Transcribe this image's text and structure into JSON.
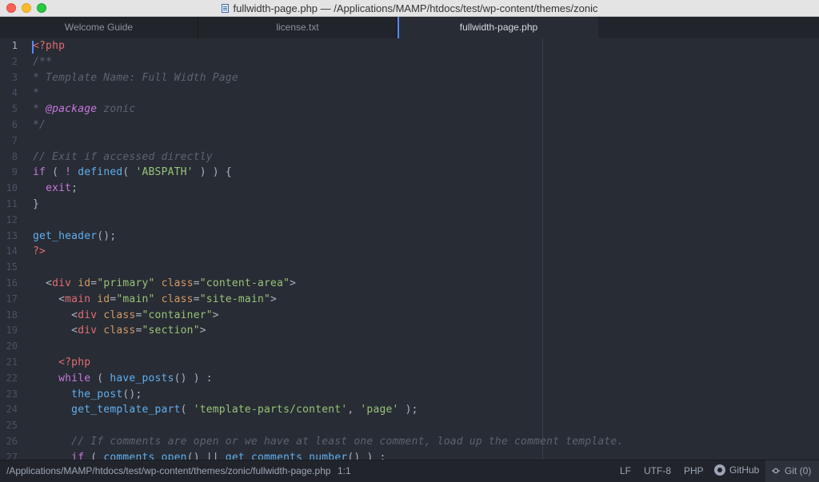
{
  "window": {
    "title": "fullwidth-page.php — /Applications/MAMP/htdocs/test/wp-content/themes/zonic"
  },
  "tabs": [
    {
      "label": "Welcome Guide",
      "active": false
    },
    {
      "label": "license.txt",
      "active": false
    },
    {
      "label": "fullwidth-page.php",
      "active": true
    }
  ],
  "editor": {
    "line_numbers": [
      "1",
      "2",
      "3",
      "4",
      "5",
      "6",
      "7",
      "8",
      "9",
      "10",
      "11",
      "12",
      "13",
      "14",
      "15",
      "16",
      "17",
      "18",
      "19",
      "20",
      "21",
      "22",
      "23",
      "24",
      "25",
      "26",
      "27"
    ],
    "lines": [
      [
        {
          "t": "<?php",
          "c": "tag"
        }
      ],
      [
        {
          "t": "/**",
          "c": "comment"
        }
      ],
      [
        {
          "t": "* Template Name: Full Width Page",
          "c": "comment"
        }
      ],
      [
        {
          "t": "*",
          "c": "comment"
        }
      ],
      [
        {
          "t": "* ",
          "c": "comment"
        },
        {
          "t": "@package",
          "c": "doc"
        },
        {
          "t": " zonic",
          "c": "comment"
        }
      ],
      [
        {
          "t": "*/",
          "c": "comment"
        }
      ],
      [],
      [
        {
          "t": "// Exit if accessed directly",
          "c": "comment"
        }
      ],
      [
        {
          "t": "if",
          "c": "kw"
        },
        {
          "t": " ( ",
          "c": "punc"
        },
        {
          "t": "!",
          "c": "kw"
        },
        {
          "t": " ",
          "c": "punc"
        },
        {
          "t": "defined",
          "c": "fn"
        },
        {
          "t": "( ",
          "c": "punc"
        },
        {
          "t": "'ABSPATH'",
          "c": "str"
        },
        {
          "t": " ) ) {",
          "c": "punc"
        }
      ],
      [
        {
          "t": "  ",
          "c": "punc"
        },
        {
          "t": "exit",
          "c": "kw"
        },
        {
          "t": ";",
          "c": "punc"
        }
      ],
      [
        {
          "t": "}",
          "c": "punc"
        }
      ],
      [],
      [
        {
          "t": "get_header",
          "c": "fn"
        },
        {
          "t": "();",
          "c": "punc"
        }
      ],
      [
        {
          "t": "?>",
          "c": "tag"
        }
      ],
      [],
      [
        {
          "t": "  <",
          "c": "punc"
        },
        {
          "t": "div",
          "c": "tag"
        },
        {
          "t": " ",
          "c": "punc"
        },
        {
          "t": "id",
          "c": "attr"
        },
        {
          "t": "=",
          "c": "punc"
        },
        {
          "t": "\"primary\"",
          "c": "str"
        },
        {
          "t": " ",
          "c": "punc"
        },
        {
          "t": "class",
          "c": "attr"
        },
        {
          "t": "=",
          "c": "punc"
        },
        {
          "t": "\"content-area\"",
          "c": "str"
        },
        {
          "t": ">",
          "c": "punc"
        }
      ],
      [
        {
          "t": "    <",
          "c": "punc"
        },
        {
          "t": "main",
          "c": "tag"
        },
        {
          "t": " ",
          "c": "punc"
        },
        {
          "t": "id",
          "c": "attr"
        },
        {
          "t": "=",
          "c": "punc"
        },
        {
          "t": "\"main\"",
          "c": "str"
        },
        {
          "t": " ",
          "c": "punc"
        },
        {
          "t": "class",
          "c": "attr"
        },
        {
          "t": "=",
          "c": "punc"
        },
        {
          "t": "\"site-main\"",
          "c": "str"
        },
        {
          "t": ">",
          "c": "punc"
        }
      ],
      [
        {
          "t": "      <",
          "c": "punc"
        },
        {
          "t": "div",
          "c": "tag"
        },
        {
          "t": " ",
          "c": "punc"
        },
        {
          "t": "class",
          "c": "attr"
        },
        {
          "t": "=",
          "c": "punc"
        },
        {
          "t": "\"container\"",
          "c": "str"
        },
        {
          "t": ">",
          "c": "punc"
        }
      ],
      [
        {
          "t": "      <",
          "c": "punc"
        },
        {
          "t": "div",
          "c": "tag"
        },
        {
          "t": " ",
          "c": "punc"
        },
        {
          "t": "class",
          "c": "attr"
        },
        {
          "t": "=",
          "c": "punc"
        },
        {
          "t": "\"section\"",
          "c": "str"
        },
        {
          "t": ">",
          "c": "punc"
        }
      ],
      [],
      [
        {
          "t": "    ",
          "c": "punc"
        },
        {
          "t": "<?php",
          "c": "tag"
        }
      ],
      [
        {
          "t": "    ",
          "c": "punc"
        },
        {
          "t": "while",
          "c": "kw"
        },
        {
          "t": " ( ",
          "c": "punc"
        },
        {
          "t": "have_posts",
          "c": "fn"
        },
        {
          "t": "() ) :",
          "c": "punc"
        }
      ],
      [
        {
          "t": "      ",
          "c": "punc"
        },
        {
          "t": "the_post",
          "c": "fn"
        },
        {
          "t": "();",
          "c": "punc"
        }
      ],
      [
        {
          "t": "      ",
          "c": "punc"
        },
        {
          "t": "get_template_part",
          "c": "fn"
        },
        {
          "t": "( ",
          "c": "punc"
        },
        {
          "t": "'template-parts/content'",
          "c": "str"
        },
        {
          "t": ", ",
          "c": "punc"
        },
        {
          "t": "'page'",
          "c": "str"
        },
        {
          "t": " );",
          "c": "punc"
        }
      ],
      [],
      [
        {
          "t": "      ",
          "c": "punc"
        },
        {
          "t": "// If comments are open or we have at least one comment, load up the comment template.",
          "c": "comment"
        }
      ],
      [
        {
          "t": "      ",
          "c": "punc"
        },
        {
          "t": "if",
          "c": "kw"
        },
        {
          "t": " ( ",
          "c": "punc"
        },
        {
          "t": "comments_open",
          "c": "fn"
        },
        {
          "t": "() || ",
          "c": "punc"
        },
        {
          "t": "get_comments_number",
          "c": "fn"
        },
        {
          "t": "() ) :",
          "c": "punc"
        }
      ]
    ]
  },
  "status": {
    "path": "/Applications/MAMP/htdocs/test/wp-content/themes/zonic/fullwidth-page.php",
    "cursor_position": "1:1",
    "line_ending": "LF",
    "encoding": "UTF-8",
    "grammar": "PHP",
    "github": "GitHub",
    "git": "Git (0)"
  },
  "colors": {
    "editor_bg": "#282c34",
    "tag": "#e06c75",
    "keyword": "#c678dd",
    "function": "#61afef",
    "string": "#98c379",
    "attribute": "#d19a66",
    "comment": "#5c6370",
    "accent": "#568af2"
  }
}
